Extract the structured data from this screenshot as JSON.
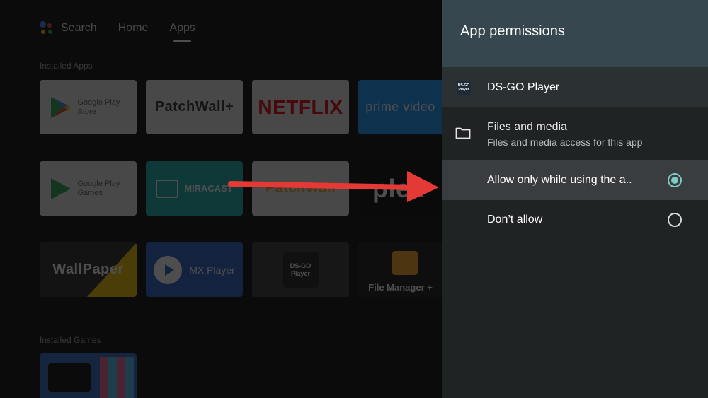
{
  "launcher": {
    "nav": {
      "search": "Search",
      "home": "Home",
      "apps": "Apps"
    },
    "installed_apps_title": "Installed Apps",
    "installed_games_title": "Installed Games",
    "apps": [
      {
        "label": "Google Play Store"
      },
      {
        "label": "PatchWall+"
      },
      {
        "label": "NETFLIX"
      },
      {
        "label": "prime video"
      },
      {
        "label": "Google Play Games"
      },
      {
        "label": "MIRACAST"
      },
      {
        "label": "PatchWall"
      },
      {
        "label": "plex"
      },
      {
        "label": "WallPaper"
      },
      {
        "label": "MX Player"
      },
      {
        "label": "DS-GO Player"
      },
      {
        "label": "File Manager +"
      }
    ]
  },
  "panel": {
    "title": "App permissions",
    "app_name": "DS-GO Player",
    "app_icon_text_top": "DS-GO",
    "app_icon_text_bottom": "Player",
    "permission": {
      "title": "Files and media",
      "subtitle": "Files and media access for this app"
    },
    "options": [
      {
        "label": "Allow only while using the a..",
        "selected": true
      },
      {
        "label": "Don’t allow",
        "selected": false
      }
    ]
  },
  "colors": {
    "panel_header": "#37474f",
    "panel_bg": "#202324",
    "radio_accent": "#80cbc4",
    "arrow": "#e53935"
  }
}
